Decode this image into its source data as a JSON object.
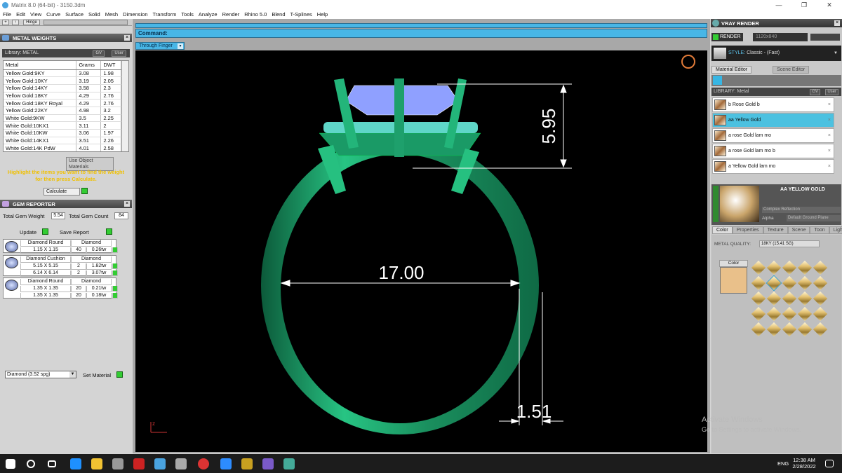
{
  "window": {
    "title": "Matrix 8.0 (64-bit) - 3150.3dm",
    "minimize": "—",
    "maximize": "❐",
    "close": "✕"
  },
  "menu": [
    "File",
    "Edit",
    "View",
    "Curve",
    "Surface",
    "Solid",
    "Mesh",
    "Dimension",
    "Transform",
    "Tools",
    "Analyze",
    "Render",
    "Rhino 5.0",
    "Blend",
    "T-Splines",
    "Help"
  ],
  "toolrow": {
    "plus": "+",
    "up": "↑",
    "hinge": "Hinge"
  },
  "metal_weights": {
    "title": "METAL WEIGHTS",
    "library_label": "Library: METAL",
    "gv_label": "GV",
    "user_label": "User",
    "columns": [
      "Metal",
      "Grams",
      "DWT"
    ],
    "rows": [
      [
        "Yellow Gold:9KY",
        "3.08",
        "1.98"
      ],
      [
        "Yellow Gold:10KY",
        "3.19",
        "2.05"
      ],
      [
        "Yellow Gold:14KY",
        "3.58",
        "2.3"
      ],
      [
        "Yellow Gold:18KY",
        "4.29",
        "2.76"
      ],
      [
        "Yellow Gold:18KY Royal",
        "4.29",
        "2.76"
      ],
      [
        "Yellow Gold:22KY",
        "4.98",
        "3.2"
      ],
      [
        "White Gold:9KW",
        "3.5",
        "2.25"
      ],
      [
        "White Gold:10KX1",
        "3.11",
        "2"
      ],
      [
        "White Gold:10KW",
        "3.06",
        "1.97"
      ],
      [
        "White Gold:14KX1",
        "3.51",
        "2.26"
      ],
      [
        "White Gold:14K PdW",
        "4.01",
        "2.58"
      ]
    ],
    "use_object_materials": "Use Object Materials",
    "hint": "Highlight the items you want to find the weight for then press Calculate.",
    "calculate": "Calculate"
  },
  "gem_reporter": {
    "title": "GEM REPORTER",
    "total_weight_label": "Total Gem Weight",
    "total_weight": "5.54",
    "total_count_label": "Total Gem Count",
    "total_count": "84",
    "update": "Update",
    "save_report": "Save Report",
    "gems": [
      {
        "name": "Diamond Round",
        "type": "Diamond",
        "rows": [
          [
            "1.15 X 1.15",
            "40",
            "0.26tw"
          ]
        ]
      },
      {
        "name": "Diamond Cushion",
        "type": "Diamond",
        "rows": [
          [
            "5.15 X 5.15",
            "2",
            "1.82tw"
          ],
          [
            "6.14 X 6.14",
            "2",
            "3.07tw"
          ]
        ]
      },
      {
        "name": "Diamond Round",
        "type": "Diamond",
        "rows": [
          [
            "1.35 X 1.35",
            "20",
            "0.21tw"
          ],
          [
            "1.35 X 1.35",
            "20",
            "0.18tw"
          ]
        ]
      }
    ],
    "material_select": "Diamond    (3.52 spg)",
    "set_material": "Set Material"
  },
  "viewport": {
    "command_label": "Command:",
    "view_name": "Through Finger",
    "dim_height": "5.95",
    "dim_width": "17.00",
    "dim_thickness": "1.51",
    "axis_z": "z",
    "ring_color": "#1fa06a",
    "gem_color": "#8fa0ff"
  },
  "vray": {
    "title": "VRAY RENDER",
    "render": "RENDER",
    "resolution": "1120x840",
    "style_label": "STYLE:",
    "style_value": "Classic - (Fast)",
    "tab_material": "Material Editor",
    "tab_scene": "Scene Editor",
    "library_label": "LIBRARY: Metal",
    "gv_label": "GV",
    "user_label": "User",
    "materials": [
      "b Rose Gold b",
      "aa Yellow Gold",
      "a rose Gold lam mo",
      "a rose Gold lam mo b",
      "a Yellow Gold lam mo"
    ],
    "selected_name": "AA YELLOW GOLD",
    "reflection": "Complex Reflection",
    "alpha_label": "Alpha",
    "ground": "Default Ground Plane",
    "sub_tabs": [
      "Color",
      "Properties",
      "Texture",
      "Scene",
      "Toon",
      "Light"
    ],
    "metal_quality_label": "METAL QUALITY:",
    "metal_quality_value": "18KY         (15.41 SG)",
    "color_label": "Color",
    "swatch_color": "#e9c08a"
  },
  "watermark": {
    "line1": "Activate Windows",
    "line2": "Go to Settings to activate Windows."
  },
  "taskbar": {
    "lang": "ENG",
    "time": "12:38 AM",
    "date": "2/28/2022"
  }
}
